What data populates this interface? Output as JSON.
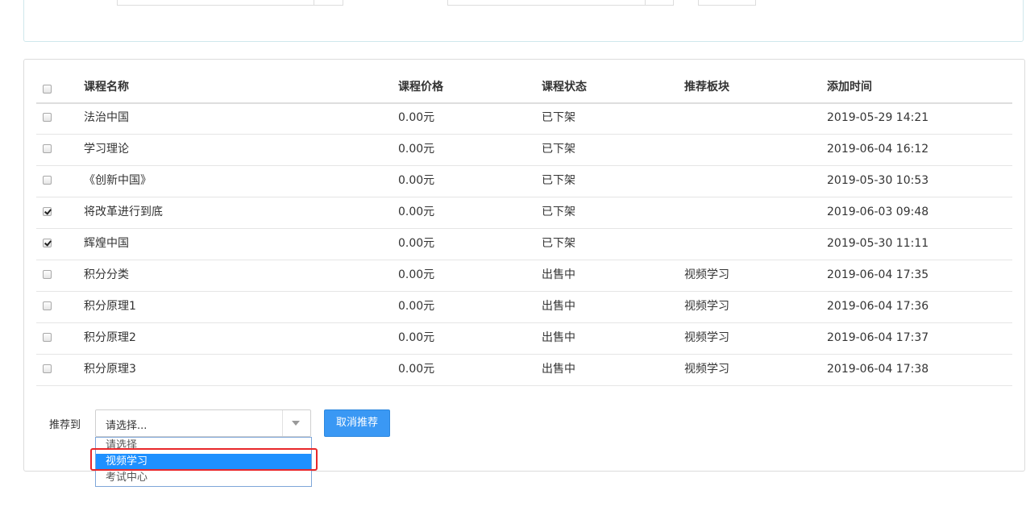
{
  "table": {
    "headers": {
      "name": "课程名称",
      "price": "课程价格",
      "status": "课程状态",
      "block": "推荐板块",
      "added": "添加时间"
    },
    "rows": [
      {
        "checked": false,
        "name": "法治中国",
        "price": "0.00元",
        "status": "已下架",
        "block": "",
        "added": "2019-05-29 14:21"
      },
      {
        "checked": false,
        "name": "学习理论",
        "price": "0.00元",
        "status": "已下架",
        "block": "",
        "added": "2019-06-04 16:12"
      },
      {
        "checked": false,
        "name": "《创新中国》",
        "price": "0.00元",
        "status": "已下架",
        "block": "",
        "added": "2019-05-30 10:53"
      },
      {
        "checked": true,
        "name": "将改革进行到底",
        "price": "0.00元",
        "status": "已下架",
        "block": "",
        "added": "2019-06-03 09:48"
      },
      {
        "checked": true,
        "name": "辉煌中国",
        "price": "0.00元",
        "status": "已下架",
        "block": "",
        "added": "2019-05-30 11:11"
      },
      {
        "checked": false,
        "name": "积分分类",
        "price": "0.00元",
        "status": "出售中",
        "block": "视频学习",
        "added": "2019-06-04 17:35"
      },
      {
        "checked": false,
        "name": "积分原理1",
        "price": "0.00元",
        "status": "出售中",
        "block": "视频学习",
        "added": "2019-06-04 17:36"
      },
      {
        "checked": false,
        "name": "积分原理2",
        "price": "0.00元",
        "status": "出售中",
        "block": "视频学习",
        "added": "2019-06-04 17:37"
      },
      {
        "checked": false,
        "name": "积分原理3",
        "price": "0.00元",
        "status": "出售中",
        "block": "视频学习",
        "added": "2019-06-04 17:38"
      }
    ]
  },
  "recommend": {
    "label": "推荐到",
    "select_value": "请选择...",
    "cancel_button": "取消推荐",
    "options": [
      {
        "label": "请选择",
        "selected": false
      },
      {
        "label": "视频学习",
        "selected": true
      },
      {
        "label": "考试中心",
        "selected": false
      }
    ]
  },
  "colors": {
    "primary_button": "#3a98f4",
    "option_highlight": "#1e90ff",
    "annotation_box": "#e8272a"
  }
}
